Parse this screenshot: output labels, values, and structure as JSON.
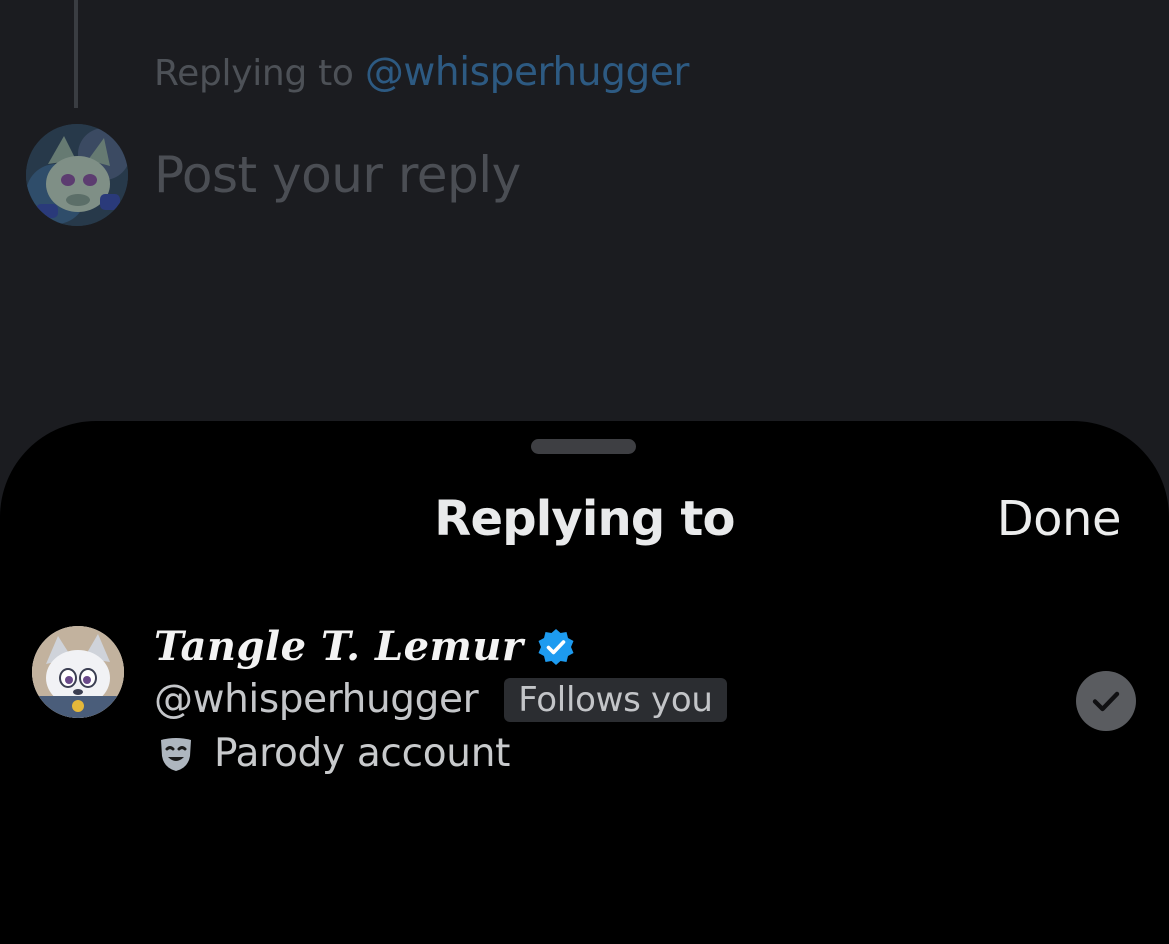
{
  "compose": {
    "replying_prefix": "Replying to",
    "replying_handle": "@whisperhugger",
    "placeholder": "Post your reply"
  },
  "sheet": {
    "title": "Replying to",
    "done_label": "Done",
    "users": [
      {
        "display_name": "Tangle T. Lemur",
        "handle": "@whisperhugger",
        "follows_badge": "Follows you",
        "account_label": "Parody account",
        "verified": true,
        "selected": true,
        "account_label_icon": "theater-mask-icon"
      }
    ]
  },
  "colors": {
    "background_dim": "#1b1c20",
    "sheet_background": "#000000",
    "verified_blue": "#1d9bf0",
    "link_dim": "#2d5a82"
  }
}
